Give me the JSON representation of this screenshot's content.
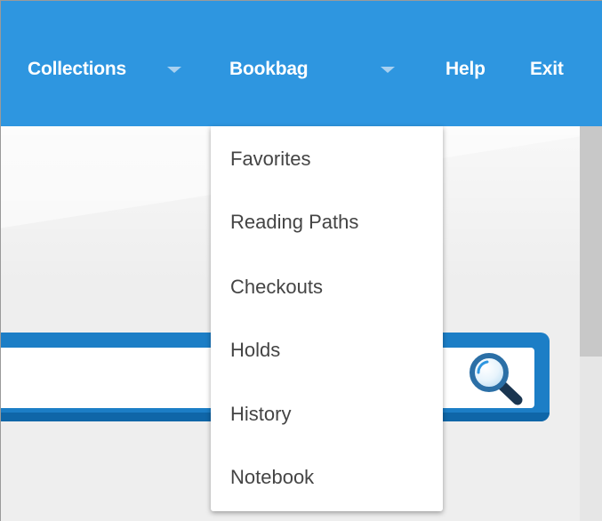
{
  "nav": {
    "collections_label": "Collections",
    "bookbag_label": "Bookbag",
    "help_label": "Help",
    "exit_label": "Exit"
  },
  "dropdown": {
    "items": [
      {
        "label": "Favorites"
      },
      {
        "label": "Reading Paths"
      },
      {
        "label": "Checkouts"
      },
      {
        "label": "Holds"
      },
      {
        "label": "History"
      },
      {
        "label": "Notebook"
      }
    ]
  },
  "search": {
    "value": "",
    "icon": "search-icon"
  },
  "colors": {
    "nav_background": "#2e96e0",
    "search_frame": "#1c7ec6",
    "menu_text": "#444444"
  }
}
